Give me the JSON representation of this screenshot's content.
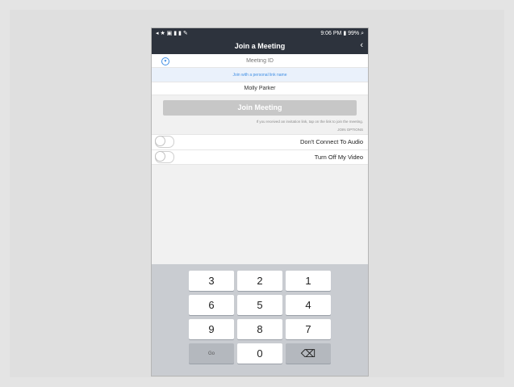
{
  "status_bar": {
    "text": "9:06 PM ▮ 99% ⌕",
    "right": "◂ ★ ▣ ▮ ▮ ✎"
  },
  "nav": {
    "title": "Join a Meeting",
    "back_label": "‹"
  },
  "form": {
    "meeting_id_placeholder": "Meeting ID",
    "personal_link": "Join with a personal link name",
    "name_value": "Molly Parker",
    "join_button": "Join Meeting",
    "invite_hint": "If you received an invitation link, tap on the link to join the meeting.",
    "options_label": "JOIN OPTIONS"
  },
  "options": [
    {
      "label": "Don't Connect To Audio",
      "enabled": false
    },
    {
      "label": "Turn Off My Video",
      "enabled": false
    }
  ],
  "keypad": [
    "1",
    "2",
    "3",
    "4",
    "5",
    "6",
    "7",
    "8",
    "9",
    "⌫",
    "0",
    "Go"
  ]
}
